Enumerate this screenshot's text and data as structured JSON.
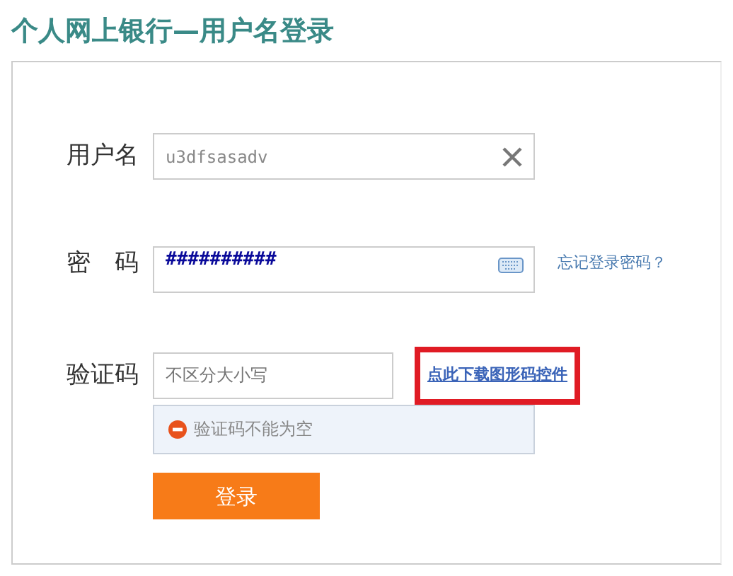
{
  "title": "个人网上银行—用户名登录",
  "username": {
    "label": "用户名",
    "value": "u3dfsasadv"
  },
  "password": {
    "label": "密　码",
    "value": "##########",
    "forgot_link": "忘记登录密码？"
  },
  "captcha": {
    "label": "验证码",
    "placeholder": "不区分大小写",
    "download_link": "点此下载图形码控件",
    "highlighted": true,
    "error": "验证码不能为空"
  },
  "login_button": "登录"
}
